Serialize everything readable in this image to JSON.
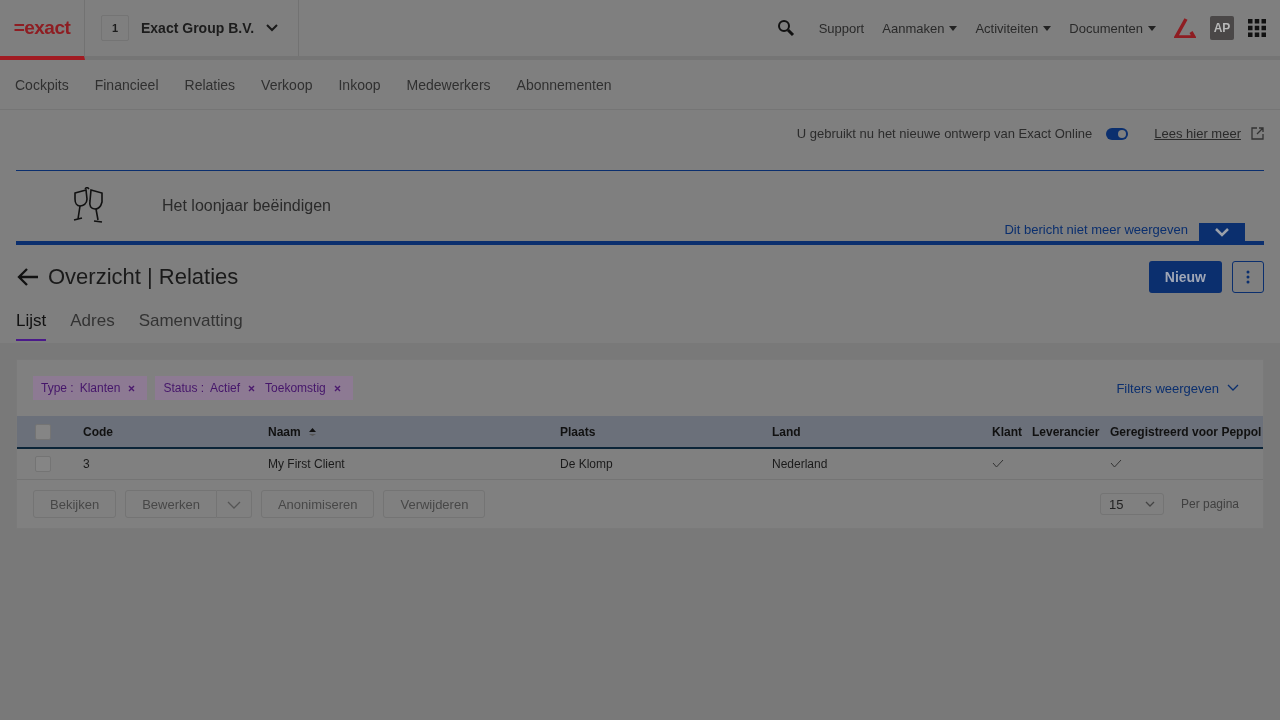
{
  "header": {
    "logo": "=exact",
    "company_number": "1",
    "company": "Exact Group B.V.",
    "links": [
      {
        "label": "Support",
        "dropdown": false
      },
      {
        "label": "Aanmaken",
        "dropdown": true
      },
      {
        "label": "Activiteiten",
        "dropdown": true
      },
      {
        "label": "Documenten",
        "dropdown": true
      }
    ],
    "avatar": "AP"
  },
  "nav": [
    "Cockpits",
    "Financieel",
    "Relaties",
    "Verkoop",
    "Inkoop",
    "Medewerkers",
    "Abonnementen"
  ],
  "design_notice": {
    "text": "U gebruikt nu het nieuwe ontwerp van Exact Online",
    "toggle_on": true,
    "link": "Lees hier meer"
  },
  "banner": {
    "title": "Het loonjaar beëindigen",
    "dismiss": "Dit bericht niet meer weergeven"
  },
  "page": {
    "title": "Overzicht | Relaties",
    "new_button": "Nieuw"
  },
  "tabs": [
    {
      "label": "Lijst",
      "selected": true
    },
    {
      "label": "Adres",
      "selected": false
    },
    {
      "label": "Samenvatting",
      "selected": false
    }
  ],
  "filters": [
    {
      "label": "Type :",
      "values": [
        "Klanten"
      ]
    },
    {
      "label": "Status :",
      "values": [
        "Actief",
        "Toekomstig"
      ]
    }
  ],
  "filters_link": "Filters weergeven",
  "table": {
    "all_checked": false,
    "columns": [
      {
        "label": "Code",
        "sorted": false
      },
      {
        "label": "Naam",
        "sorted": true
      },
      {
        "label": "Plaats",
        "sorted": false
      },
      {
        "label": "Land",
        "sorted": false
      },
      {
        "label": "Klant",
        "sorted": false
      },
      {
        "label": "Leverancier",
        "sorted": false
      },
      {
        "label": "Geregistreerd voor Peppol",
        "sorted": false
      }
    ],
    "rows": [
      {
        "checked": false,
        "code": "3",
        "naam": "My First Client",
        "plaats": "De Klomp",
        "land": "Nederland",
        "klant": true,
        "leverancier": false,
        "peppol": true
      }
    ]
  },
  "actions": [
    "Bekijken",
    "Bewerken",
    "Anonimiseren",
    "Verwijderen"
  ],
  "pagination": {
    "page_size": "15",
    "label": "Per pagina"
  }
}
